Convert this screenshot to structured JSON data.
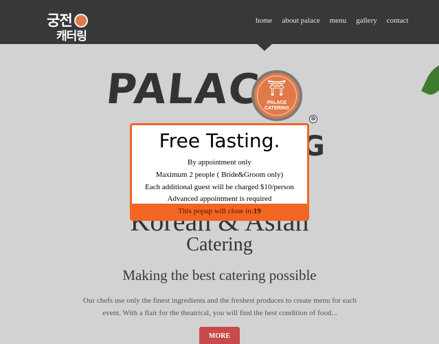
{
  "header": {
    "brand_line1": "궁전",
    "brand_line2": "캐터링",
    "nav": [
      "home",
      "about palace",
      "menu",
      "gallery",
      "contact"
    ]
  },
  "hero": {
    "word1": "PALACE",
    "word2": "G",
    "logo_caption_line1": "PALACE",
    "logo_caption_line2": "CATERING",
    "subtitle1": "Korean & Asian",
    "subtitle2": "Catering",
    "tagline": "Making the best catering possible",
    "description": "Our chefs use only the finest ingredients and the freshest produces to create menu for each event. With a flair for the theatrical, you will find the best condition of food...",
    "more_label": "MORE"
  },
  "popup": {
    "title": "Free Tasting.",
    "lines": [
      "By appointment only",
      "Maximum 2 people ( Bride&Groom only)",
      "Each additional guest will be charged $10/person",
      "Advanced appointment is required"
    ],
    "footer_text": "This popup will close in:",
    "countdown": "19",
    "close_symbol": "⊗"
  },
  "colors": {
    "header_bg": "#383838",
    "page_bg": "#d2d2d2",
    "accent_orange": "#f26522",
    "button_red": "#c84a4a",
    "logo_orange": "#e07a4a"
  },
  "icons": {
    "close": "close-icon",
    "logo": "palace-catering-logo",
    "leaf": "leaf-decoration"
  }
}
